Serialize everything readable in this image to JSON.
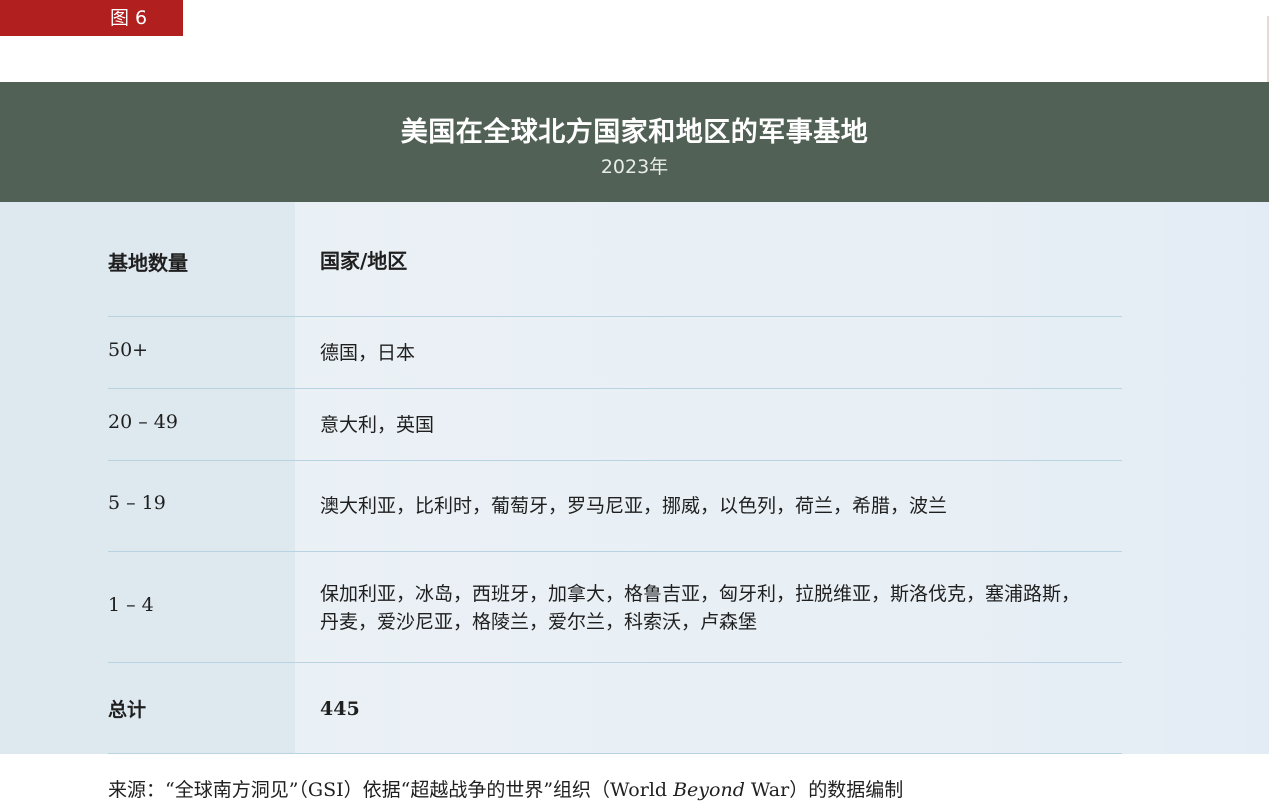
{
  "figure_tag": "图 6",
  "header": {
    "title": "美国在全球北方国家和地区的军事基地",
    "subtitle": "2023年"
  },
  "table": {
    "columns": {
      "count": "基地数量",
      "countries": "国家/地区"
    },
    "rows": [
      {
        "count": "50+",
        "countries": "德国，日本"
      },
      {
        "count": "20 – 49",
        "countries": "意大利，英国"
      },
      {
        "count": "5 – 19",
        "countries": "澳大利亚，比利时，葡萄牙，罗马尼亚，挪威，以色列，荷兰，希腊，波兰"
      },
      {
        "count": "1 – 4",
        "countries_line1": "保加利亚，冰岛，西班牙，加拿大，格鲁吉亚，匈牙利，拉脱维亚，斯洛伐克，塞浦路斯，",
        "countries_line2": "丹麦，爱沙尼亚，格陵兰，爱尔兰，科索沃，卢森堡"
      }
    ],
    "total": {
      "label": "总计",
      "value": "445"
    }
  },
  "source": {
    "prefix": "来源：“全球南方洞见”（GSI）依据“超越战争的世界”组织（World ",
    "italic": "Beyond",
    "suffix": " War）的数据编制"
  },
  "colors": {
    "tag_red": "#b21f1f",
    "header_green": "#526156",
    "panel_blue": "#eaf1f5",
    "rule_blue": "#b9d3e3"
  }
}
